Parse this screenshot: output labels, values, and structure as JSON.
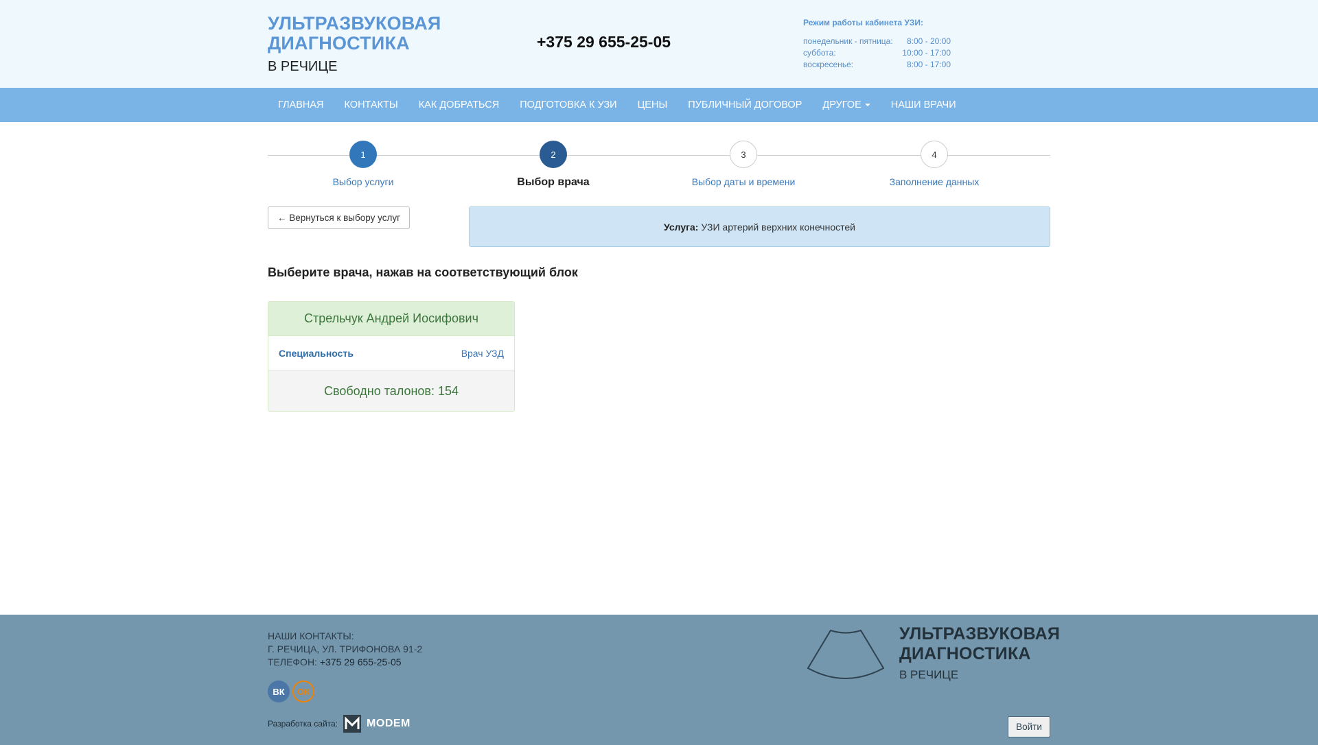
{
  "header": {
    "brand_line1": "УЛЬТРАЗВУКОВАЯ",
    "brand_line2": "ДИАГНОСТИКА",
    "brand_sub": "В РЕЧИЦЕ",
    "phone": "+375 29 655-25-05",
    "hours_title": "Режим работы кабинета УЗИ:",
    "hours": [
      {
        "day": "понедельник - пятница:",
        "time": "8:00 - 20:00"
      },
      {
        "day": "суббота:",
        "time": "10:00 - 17:00"
      },
      {
        "day": "воскресенье:",
        "time": "8:00 - 17:00"
      }
    ]
  },
  "nav": {
    "items": [
      "ГЛАВНАЯ",
      "КОНТАКТЫ",
      "КАК ДОБРАТЬСЯ",
      "ПОДГОТОВКА К УЗИ",
      "ЦЕНЫ",
      "ПУБЛИЧНЫЙ ДОГОВОР",
      "ДРУГОЕ",
      "НАШИ ВРАЧИ"
    ]
  },
  "steps": [
    {
      "num": "1",
      "label": "Выбор услуги",
      "state": "done"
    },
    {
      "num": "2",
      "label": "Выбор врача",
      "state": "active"
    },
    {
      "num": "3",
      "label": "Выбор даты и времени",
      "state": "todo"
    },
    {
      "num": "4",
      "label": "Заполнение данных",
      "state": "todo"
    }
  ],
  "back_button": "← Вернуться к выбору услуг",
  "service": {
    "key": "Услуга:",
    "value": "УЗИ артерий верхних конечностей"
  },
  "choose_title": "Выберите врача, нажав на соответствующий блок",
  "doctor": {
    "name": "Стрельчук Андрей Иосифович",
    "spec_key": "Специальность",
    "spec_value": "Врач УЗД",
    "free_slots": "Свободно талонов: 154"
  },
  "footer": {
    "contacts_title": "НАШИ КОНТАКТЫ:",
    "address": "Г. РЕЧИЦА, УЛ. ТРИФОНОВА 91-2",
    "phone_label": "ТЕЛЕФОН:",
    "phone_value": "+375 29 655-25-05",
    "vk": "ВК",
    "ok": "ОК",
    "dev_label": "Разработка сайта:",
    "dev_name": "MODEM",
    "brand_line1": "УЛЬТРАЗВУКОВАЯ",
    "brand_line2": "ДИАГНОСТИКА",
    "brand_sub": "В РЕЧИЦЕ",
    "login": "Войти"
  }
}
